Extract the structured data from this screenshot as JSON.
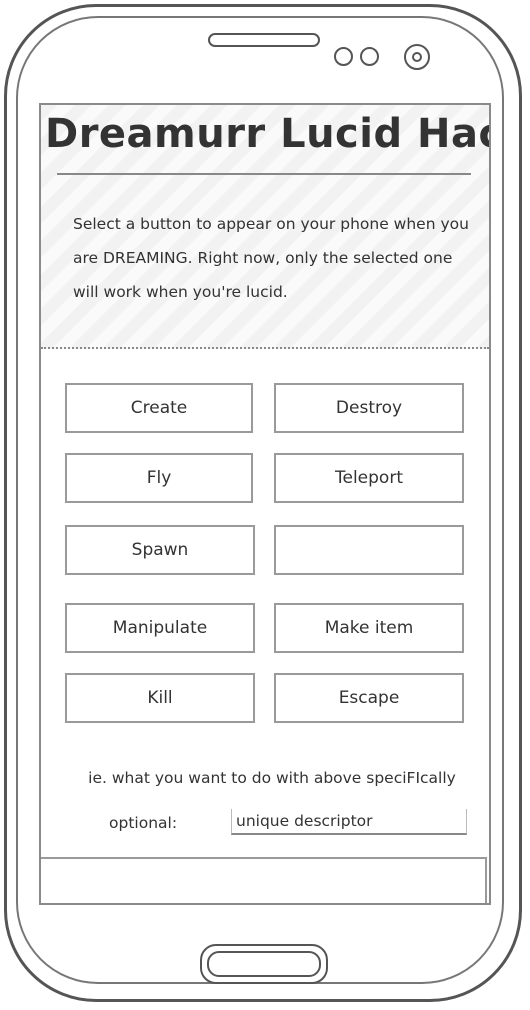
{
  "header": {
    "title": "Dreamurr Lucid Hacks",
    "instructions": "Select a button to appear on your phone when you are DREAMING. Right now, only the selected one will work when you're lucid."
  },
  "buttons": [
    {
      "label": "Create"
    },
    {
      "label": "Destroy"
    },
    {
      "label": "Fly"
    },
    {
      "label": "Teleport"
    },
    {
      "label": "Spawn"
    },
    {
      "label": ""
    },
    {
      "label": "Manipulate"
    },
    {
      "label": "Make item"
    },
    {
      "label": "Kill"
    },
    {
      "label": "Escape"
    }
  ],
  "details": {
    "help_text": "ie. what you want to do with above speciFIcally",
    "optional_label": "optional:",
    "descriptor_placeholder": "unique descriptor"
  }
}
